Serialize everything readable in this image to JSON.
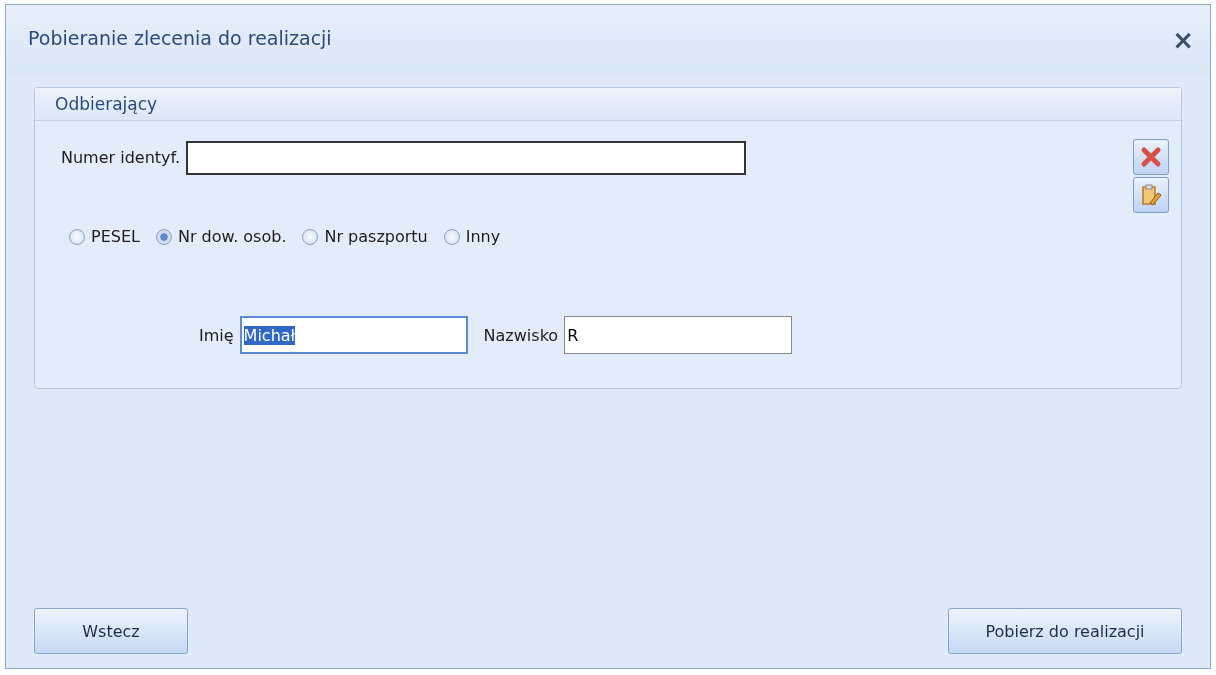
{
  "window": {
    "title": "Pobieranie zlecenia do realizacji",
    "close": "×"
  },
  "group": {
    "title": "Odbierający",
    "id_field": {
      "label": "Numer identyf."
    },
    "id_types": [
      {
        "label": "PESEL",
        "selected": false
      },
      {
        "label": "Nr dow. osob.",
        "selected": true
      },
      {
        "label": "Nr paszportu",
        "selected": false
      },
      {
        "label": "Inny",
        "selected": false
      }
    ],
    "fields": [
      {
        "label": "Imię",
        "value": "Michał",
        "text_selected": true
      },
      {
        "label": "Nazwisko",
        "value": "R",
        "text_selected": false
      }
    ]
  },
  "buttons": [
    {
      "label": "Wstecz"
    },
    {
      "label": "Pobierz do realizacji"
    }
  ]
}
